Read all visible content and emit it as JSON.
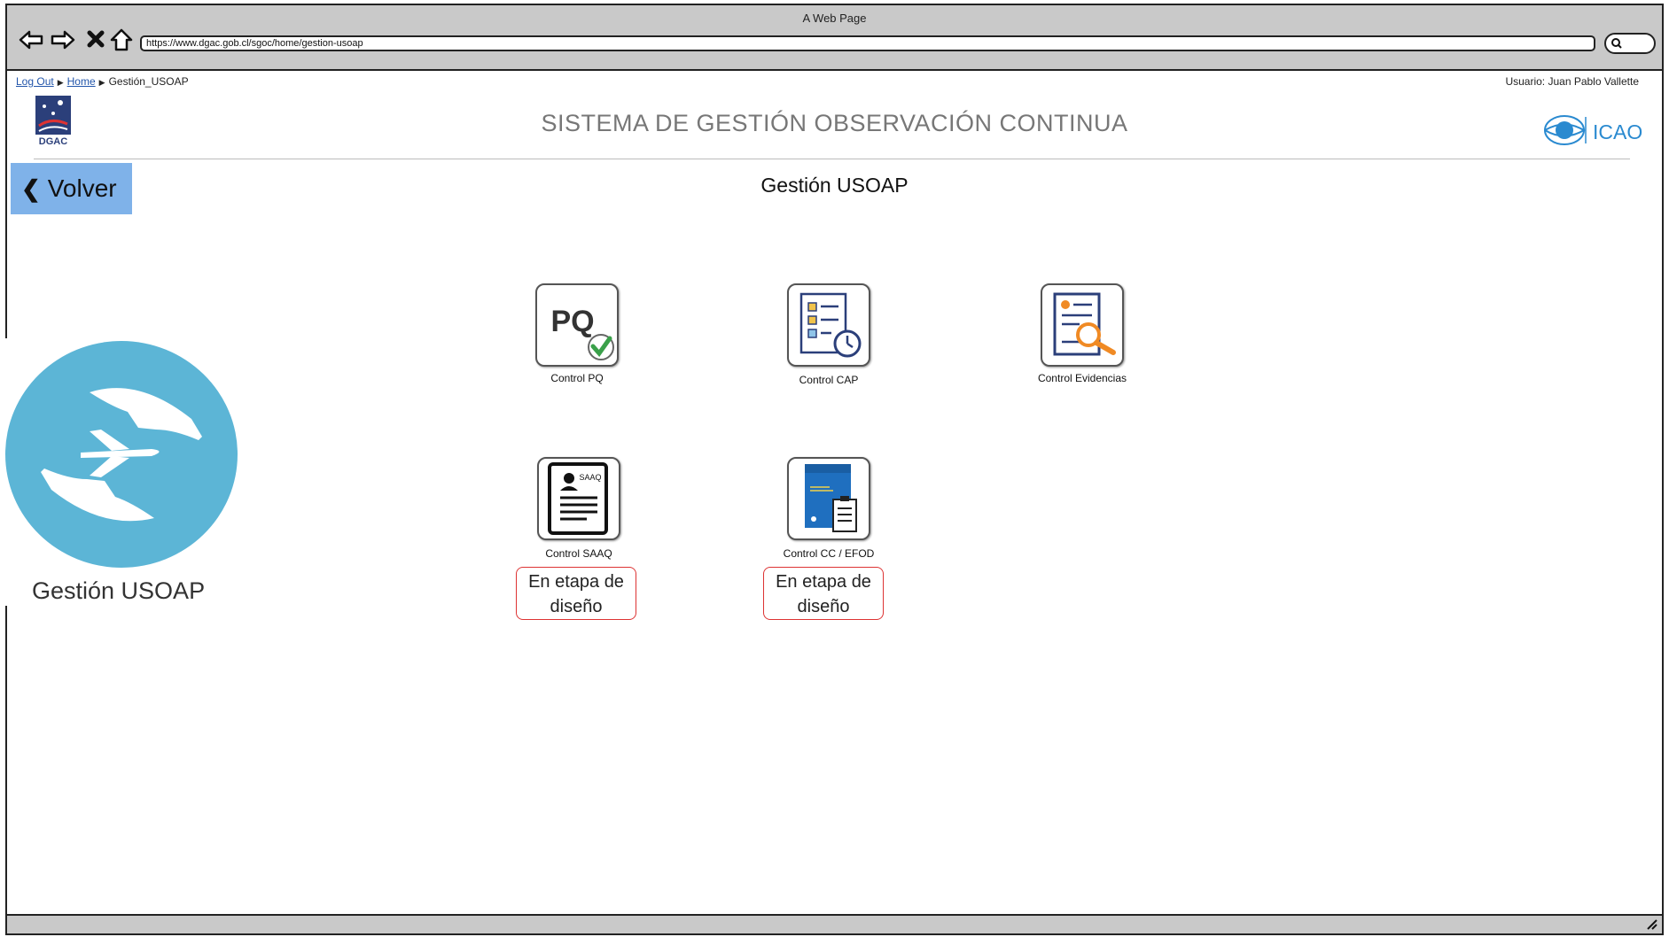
{
  "browser": {
    "window_title": "A Web Page",
    "url": "https://www.dgac.gob.cl/sgoc/home/gestion-usoap"
  },
  "breadcrumb": {
    "items": [
      "Log Out",
      "Home",
      "Gestión_USOAP"
    ]
  },
  "user_label": "Usuario: Juan Pablo Vallette",
  "header": {
    "title": "SISTEMA DE GESTIÓN OBSERVACIÓN CONTINUA",
    "logo_left": "DGAC",
    "logo_right": "ICAO"
  },
  "back_button": "Volver",
  "page_heading": "Gestión USOAP",
  "tiles": [
    {
      "label": "Control PQ",
      "icon": "pq-check-icon"
    },
    {
      "label": "Control CAP",
      "icon": "checklist-stopwatch-icon"
    },
    {
      "label": "Control Evidencias",
      "icon": "document-magnifier-icon"
    },
    {
      "label": "Control SAAQ",
      "icon": "saaq-form-icon"
    },
    {
      "label": "Control CC / EFOD",
      "icon": "manual-clipboard-icon"
    }
  ],
  "design_notes": [
    "En etapa de diseño",
    "En etapa de diseño"
  ],
  "side_panel": {
    "title": "Gestión USOAP",
    "icon": "hands-airplane-icon"
  },
  "colors": {
    "volver_bg": "#7fb2e9",
    "circle": "#5cb5d6",
    "icao_blue": "#2a8ad0",
    "note_border": "#dd3333"
  }
}
